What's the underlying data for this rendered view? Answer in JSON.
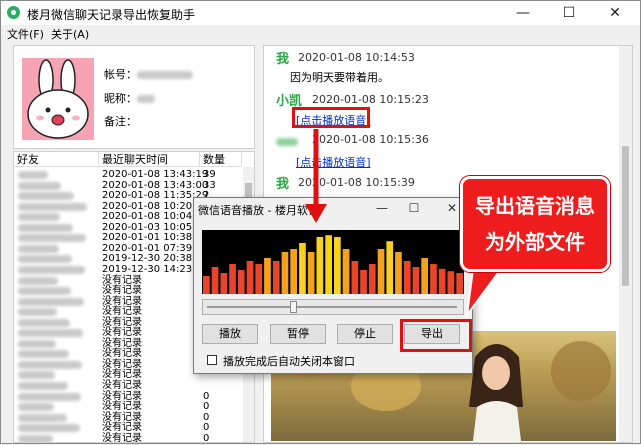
{
  "window": {
    "title": "楼月微信聊天记录导出恢复助手",
    "accent": "#2aae67"
  },
  "menu": [
    "文件(F)",
    "关于(A)"
  ],
  "profile": {
    "account_label": "帐号：",
    "nickname_label": "昵称：",
    "note_label": "备注："
  },
  "friend_list": {
    "columns": [
      "好友",
      "最近聊天时间",
      "数量"
    ],
    "rows": [
      {
        "time": "2020-01-08 13:43:19",
        "count": "39"
      },
      {
        "time": "2020-01-08 13:43:00",
        "count": "33"
      },
      {
        "time": "2020-01-08 11:35:29",
        "count": "2"
      },
      {
        "time": "2020-01-08 10:20:10",
        "count": ""
      },
      {
        "time": "2020-01-08 10:04:21",
        "count": ""
      },
      {
        "time": "2020-01-03 10:05:18",
        "count": ""
      },
      {
        "time": "2020-01-01 10:38:35",
        "count": ""
      },
      {
        "time": "2020-01-01 07:39:55",
        "count": ""
      },
      {
        "time": "2019-12-30 20:38:32",
        "count": ""
      },
      {
        "time": "2019-12-30 14:23:22",
        "count": ""
      },
      {
        "time": "没有记录",
        "count": ""
      },
      {
        "time": "没有记录",
        "count": ""
      },
      {
        "time": "没有记录",
        "count": ""
      },
      {
        "time": "没有记录",
        "count": ""
      },
      {
        "time": "没有记录",
        "count": ""
      },
      {
        "time": "没有记录",
        "count": ""
      },
      {
        "time": "没有记录",
        "count": ""
      },
      {
        "time": "没有记录",
        "count": ""
      },
      {
        "time": "没有记录",
        "count": ""
      },
      {
        "time": "没有记录",
        "count": ""
      },
      {
        "time": "没有记录",
        "count": ""
      },
      {
        "time": "没有记录",
        "count": "0"
      },
      {
        "time": "没有记录",
        "count": "0"
      },
      {
        "time": "没有记录",
        "count": "0"
      },
      {
        "time": "没有记录",
        "count": "0"
      },
      {
        "time": "没有记录",
        "count": "0"
      }
    ]
  },
  "chat": {
    "messages": [
      {
        "name": "我",
        "time": "2020-01-08 10:14:53",
        "text": "因为明天要带着用。"
      },
      {
        "name": "小凯",
        "time": "2020-01-08 10:15:23",
        "link": "[点击播放语音]"
      },
      {
        "name": "",
        "time": "2020-01-08 10:15:36",
        "link": "[点击播放语音]"
      },
      {
        "name": "我",
        "time": "2020-01-08 10:15:39"
      }
    ]
  },
  "player": {
    "title": "微信语音播放 - 楼月软件",
    "levels": [
      0.3,
      0.45,
      0.35,
      0.5,
      0.4,
      0.55,
      0.5,
      0.6,
      0.55,
      0.7,
      0.75,
      0.85,
      0.7,
      0.95,
      0.98,
      0.95,
      0.75,
      0.55,
      0.4,
      0.5,
      0.75,
      0.88,
      0.7,
      0.55,
      0.45,
      0.6,
      0.5,
      0.42,
      0.38,
      0.35
    ],
    "position": 0.33,
    "buttons": [
      "播放",
      "暂停",
      "停止",
      "导出"
    ],
    "checkbox_label": "播放完成后自动关闭本窗口"
  },
  "annotation": {
    "callout_lines": [
      "导出语音消息",
      "为外部文件"
    ],
    "color": "#ee1c1c"
  }
}
